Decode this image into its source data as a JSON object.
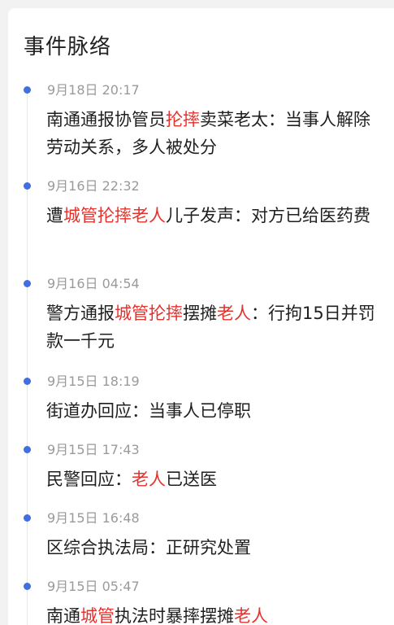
{
  "section": {
    "title": "事件脉络"
  },
  "colors": {
    "accent_dot": "#3f6fe0",
    "highlight": "#e5322d",
    "text": "#1f1f1f",
    "time_text": "#9a9a9a"
  },
  "events": [
    {
      "time": "9月18日 20:17",
      "segments": [
        {
          "text": "南通通报协管员",
          "hl": false
        },
        {
          "text": "抡摔",
          "hl": true
        },
        {
          "text": "卖菜老太：当事人解除劳动关系，多人被处分",
          "hl": false
        }
      ]
    },
    {
      "time": "9月16日 22:32",
      "segments": [
        {
          "text": "遭",
          "hl": false
        },
        {
          "text": "城管抡摔老人",
          "hl": true
        },
        {
          "text": "儿子发声：对方已给医药费",
          "hl": false
        }
      ]
    },
    {
      "time": "9月16日 04:54",
      "segments": [
        {
          "text": "警方通报",
          "hl": false
        },
        {
          "text": "城管抡摔",
          "hl": true
        },
        {
          "text": "摆摊",
          "hl": false
        },
        {
          "text": "老人",
          "hl": true
        },
        {
          "text": "：行拘15日并罚款一千元",
          "hl": false
        }
      ]
    },
    {
      "time": "9月15日 18:19",
      "segments": [
        {
          "text": "街道办回应：当事人已停职",
          "hl": false
        }
      ]
    },
    {
      "time": "9月15日 17:43",
      "segments": [
        {
          "text": "民警回应：",
          "hl": false
        },
        {
          "text": "老人",
          "hl": true
        },
        {
          "text": "已送医",
          "hl": false
        }
      ]
    },
    {
      "time": "9月15日 16:48",
      "segments": [
        {
          "text": "区综合执法局：正研究处置",
          "hl": false
        }
      ]
    },
    {
      "time": "9月15日 05:47",
      "segments": [
        {
          "text": "南通",
          "hl": false
        },
        {
          "text": "城管",
          "hl": true
        },
        {
          "text": "执法时暴摔摆摊",
          "hl": false
        },
        {
          "text": "老人",
          "hl": true
        }
      ]
    }
  ]
}
